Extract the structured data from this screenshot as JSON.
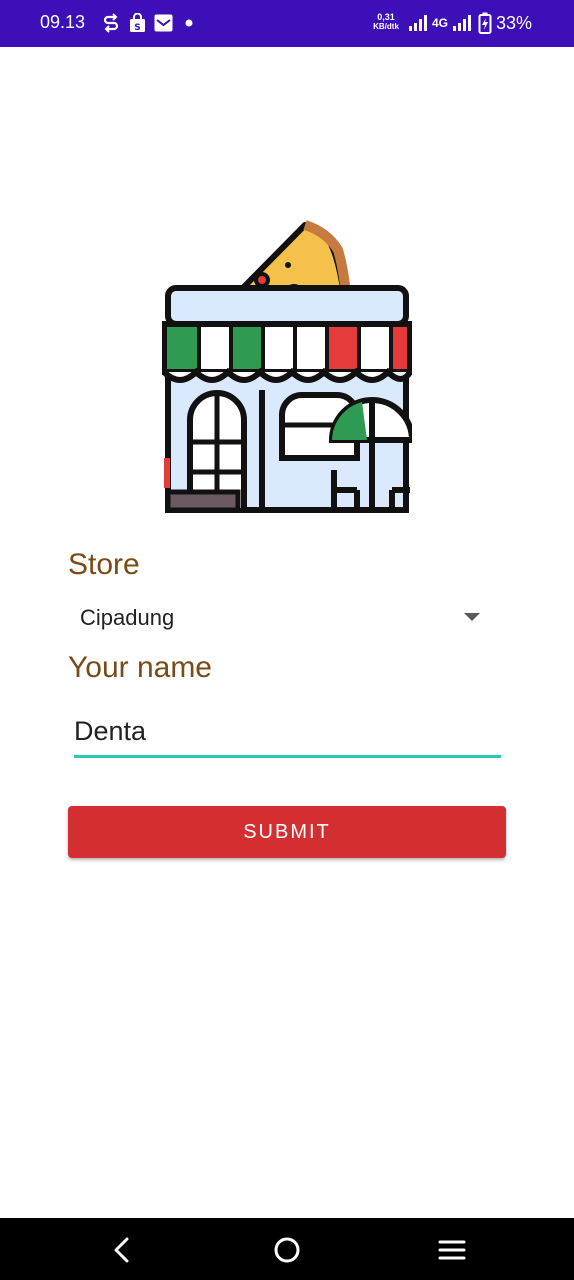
{
  "status_bar": {
    "time": "09.13",
    "network_speed_value": "0,31",
    "network_speed_unit": "KB/dtk",
    "network_type": "4G",
    "battery": "33%",
    "icons": [
      "sync-icon",
      "shopping-bag-icon",
      "mail-icon",
      "dot-icon",
      "signal-icon",
      "signal-4g-icon",
      "battery-charging-icon"
    ]
  },
  "form": {
    "store_label": "Store",
    "store_value": "Cipadung",
    "name_label": "Your name",
    "name_value": "Denta",
    "submit_label": "SUBMIT"
  },
  "colors": {
    "status_bar": "#3d0fb8",
    "label": "#7a4a17",
    "field_underline": "#2dc7b6",
    "submit": "#d32f30"
  },
  "nav_bar": {
    "icons": [
      "back-icon",
      "home-icon",
      "recents-icon"
    ]
  }
}
